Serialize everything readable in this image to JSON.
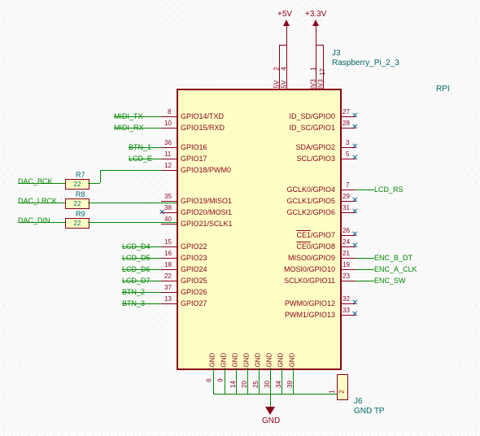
{
  "power": {
    "v5": "+5V",
    "v3": "+3.3V",
    "gnd": "GND"
  },
  "conn": {
    "j3_ref": "J3",
    "j3_name": "Raspberry_Pi_2_3",
    "rpi": "RPI",
    "j6_ref": "J6",
    "j6_name": "GND TP"
  },
  "resistors": {
    "r7_ref": "R7",
    "r7_val": "22",
    "r8_ref": "R8",
    "r8_val": "22",
    "r9_ref": "R9",
    "r9_val": "22"
  },
  "nets": {
    "midi_tx": "MIDI_TX",
    "midi_rx": "MIDI_RX",
    "btn1": "BTN_1",
    "lcd_e": "LCD_E",
    "dac_bck": "DAC_BCK",
    "dac_lrck": "DAC_LRCK",
    "dac_din": "DAC_DIN",
    "lcd_d4": "LCD_D4",
    "lcd_d5": "LCD_D5",
    "lcd_d6": "LCD_D6",
    "lcd_d7": "LCD_D7",
    "btn2": "BTN_2",
    "btn3": "BTN_3",
    "lcd_rs": "LCD_RS",
    "enc_b": "ENC_B_DT",
    "enc_a": "ENC_A_CLK",
    "enc_sw": "ENC_SW"
  },
  "pins_left": {
    "gpio14": "GPIO14/TXD",
    "gpio15": "GPIO15/RXD",
    "gpio16": "GPIO16",
    "gpio17": "GPIO17",
    "gpio18": "GPIO18/PWM0",
    "gpio19": "GPIO19/MISO1",
    "gpio20": "GPIO20/MOSI1",
    "gpio21": "GPIO21/SCLK1",
    "gpio22": "GPIO22",
    "gpio23": "GPIO23",
    "gpio24": "GPIO24",
    "gpio25": "GPIO25",
    "gpio26": "GPIO26",
    "gpio27": "GPIO27"
  },
  "pins_right": {
    "id_sd": "ID_SD/GPIO0",
    "id_sc": "ID_SC/GPIO1",
    "sda": "SDA/GPIO2",
    "scl": "SCL/GPIO3",
    "gclk0": "GCLK0/GPIO4",
    "gclk1": "GCLK1/GPIO5",
    "gclk2": "GCLK2/GPIO6",
    "ce1": "/GPIO7",
    "ce0": "/GPIO8",
    "miso0": "MISO0/GPIO9",
    "mosi0": "MOSI0/GPIO10",
    "sclk0": "SCLK0/GPIO11",
    "pwm0": "PWM0/GPIO12",
    "pwm1": "PWM1/GPIO13"
  },
  "overlines": {
    "ce1": "CE1",
    "ce0": "CE0"
  },
  "pin_nums": {
    "n8": "8",
    "n10": "10",
    "n36": "36",
    "n11": "11",
    "n12": "12",
    "n35": "35",
    "n38": "38",
    "n40": "40",
    "n15": "15",
    "n16": "16",
    "n18": "18",
    "n22": "22",
    "n37": "37",
    "n13": "13",
    "n27": "27",
    "n28": "28",
    "n3": "3",
    "n5": "5",
    "n7": "7",
    "n29": "29",
    "n31": "31",
    "n26": "26",
    "n24": "24",
    "n21": "21",
    "n19": "19",
    "n23": "23",
    "n32": "32",
    "n33": "33",
    "n2": "2",
    "n4": "4",
    "n1": "1",
    "n17": "17",
    "n6": "6",
    "n9": "9",
    "n14": "14",
    "n20": "20",
    "n25": "25",
    "n30": "30",
    "n34": "34",
    "n39": "39",
    "tp1": "1",
    "tp2": "2"
  },
  "top_labels": {
    "v5_1": "5V",
    "v5_2": "5V",
    "v3_1": "3V3",
    "v3_2": "3V3"
  },
  "bot_labels": {
    "g": "GND"
  }
}
